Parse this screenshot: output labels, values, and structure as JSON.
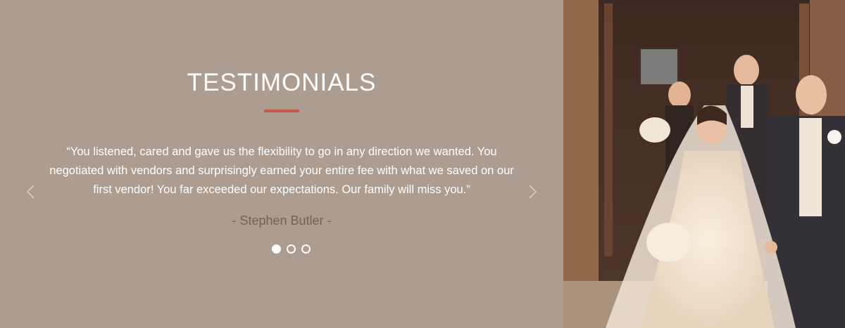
{
  "testimonials": {
    "title": "TESTIMONIALS",
    "quote": "“You listened, cared and gave us the flexibility to go in any direction we wanted. You negotiated with vendors and surprisingly earned your entire fee with what we saved on our first vendor! You far exceeded our expectations. Our family will miss you.”",
    "author": "- Stephen Butler -",
    "active_slide": 1,
    "slide_count": 3,
    "prev_icon": "chevron-left-icon",
    "next_icon": "chevron-right-icon"
  },
  "colors": {
    "panel_bg": "#ad9d91",
    "accent": "#c8564d",
    "author_text": "#6f625a"
  },
  "photo": {
    "subject": "wedding-couple-photo"
  }
}
